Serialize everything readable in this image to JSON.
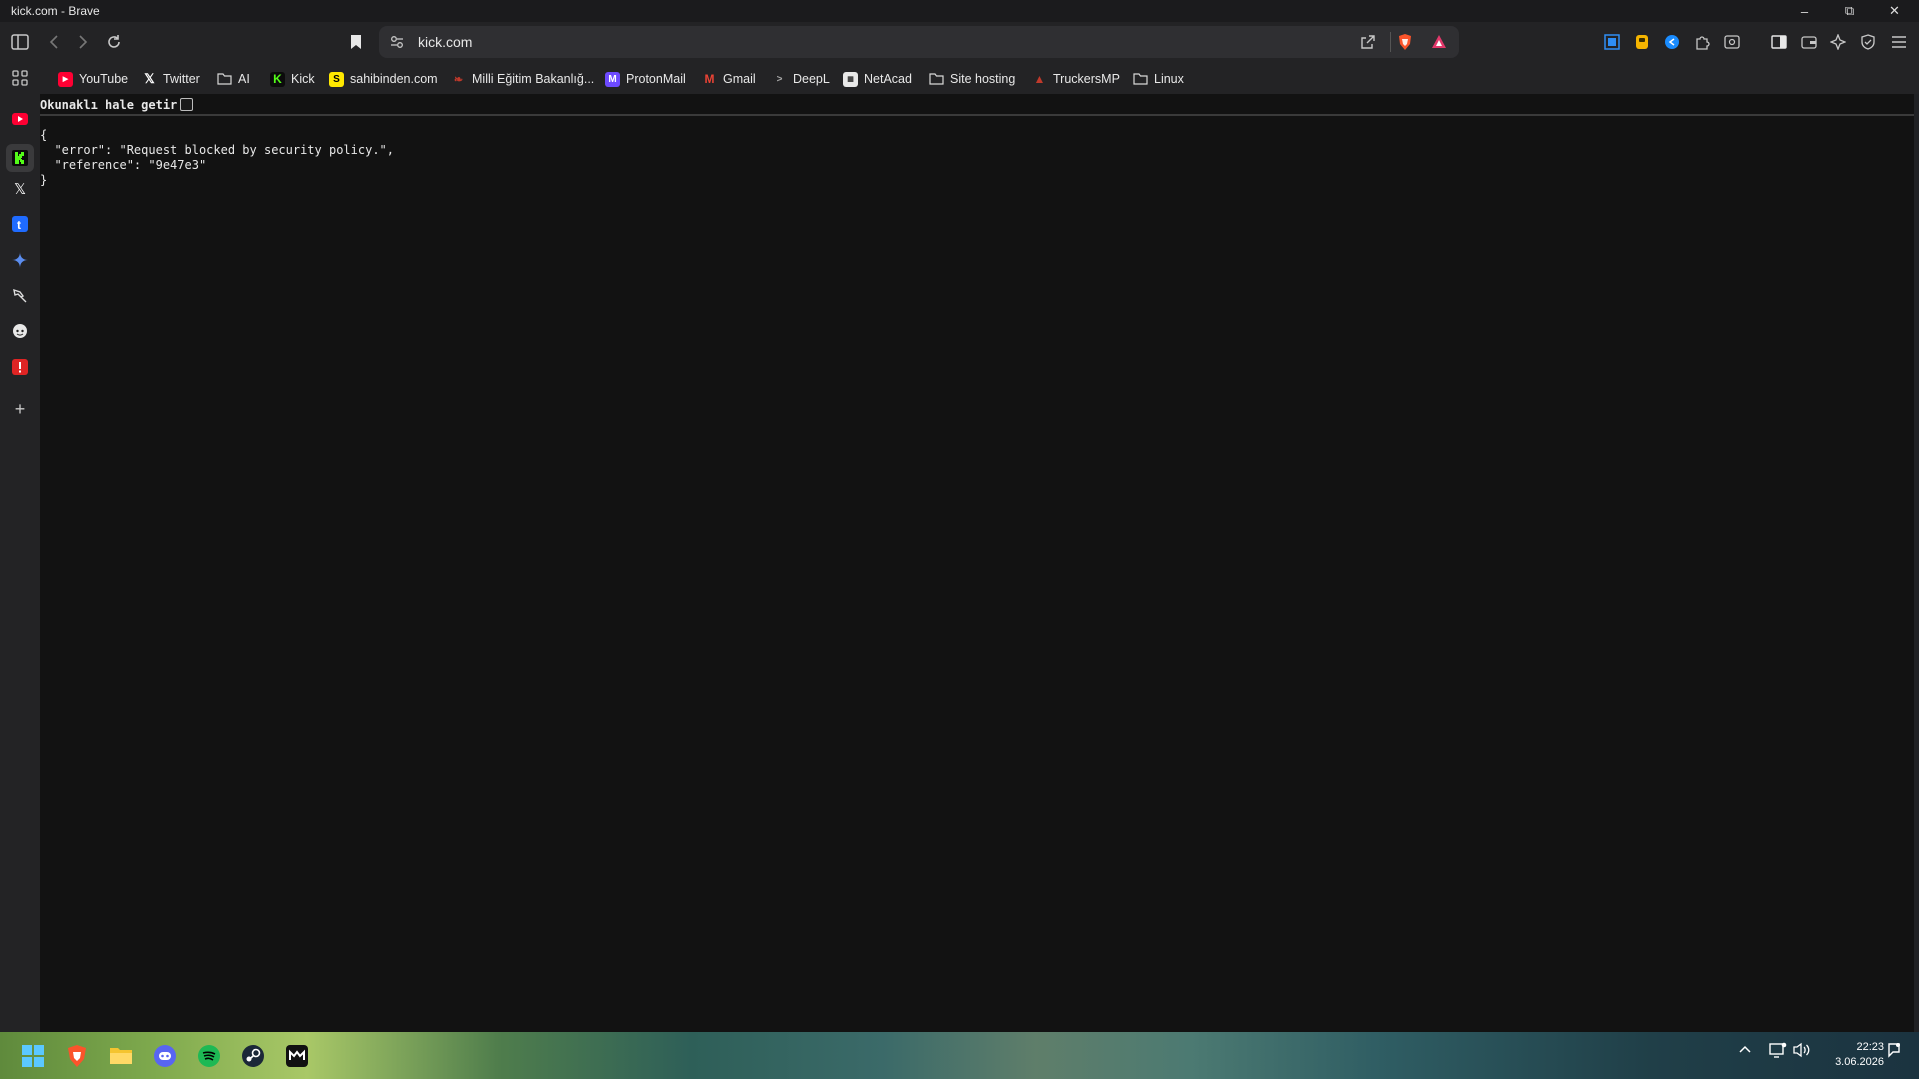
{
  "window": {
    "title": "kick.com - Brave"
  },
  "address_bar": {
    "url": "kick.com"
  },
  "bookmarks": [
    {
      "label": "YouTube",
      "icon": "youtube-icon"
    },
    {
      "label": "Twitter",
      "icon": "x-icon"
    },
    {
      "label": "AI",
      "icon": "folder-icon"
    },
    {
      "label": "Kick",
      "icon": "kick-icon"
    },
    {
      "label": "sahibinden.com",
      "icon": "sahibinden-icon"
    },
    {
      "label": "Milli Eğitim Bakanlığ...",
      "icon": "meb-icon"
    },
    {
      "label": "ProtonMail",
      "icon": "protonmail-icon"
    },
    {
      "label": "Gmail",
      "icon": "gmail-icon"
    },
    {
      "label": "DeepL",
      "icon": "deepl-icon"
    },
    {
      "label": "NetAcad",
      "icon": "netacad-icon"
    },
    {
      "label": "Site hosting",
      "icon": "folder-icon"
    },
    {
      "label": "TruckersMP",
      "icon": "truckersmp-icon"
    },
    {
      "label": "Linux",
      "icon": "folder-icon"
    }
  ],
  "reader": {
    "label": "Okunaklı hale getir"
  },
  "page": {
    "json_text": "{\n  \"error\": \"Request blocked by security policy.\",\n  \"reference\": \"9e47e3\"\n}"
  },
  "clock": {
    "time": "22:23",
    "date": "3.06.2026"
  },
  "colors": {
    "youtube": "#ff0033",
    "kick": "#53fc18",
    "brave": "#fb542b",
    "background": "#121212"
  }
}
